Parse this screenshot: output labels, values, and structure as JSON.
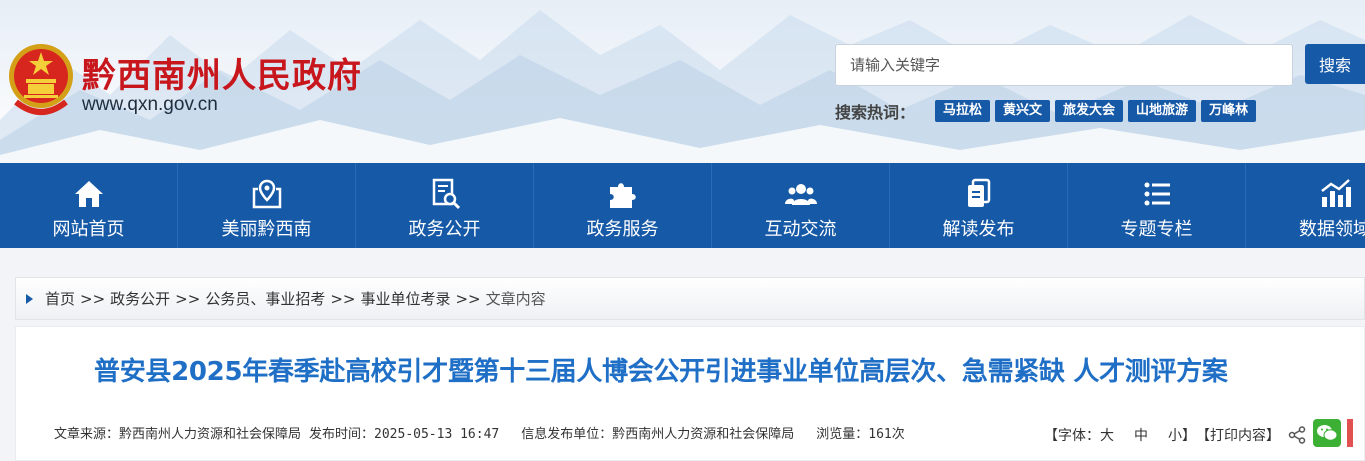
{
  "header": {
    "site_title": "黔西南州人民政府",
    "site_url": "www.qxn.gov.cn",
    "search_placeholder": "请输入关键字",
    "search_button": "搜索",
    "hot_label": "搜索热词：",
    "hot_tags": [
      "马拉松",
      "黄兴文",
      "旅发大会",
      "山地旅游",
      "万峰林"
    ]
  },
  "nav": {
    "items": [
      {
        "label": "网站首页",
        "icon": "home-icon"
      },
      {
        "label": "美丽黔西南",
        "icon": "map-pin-icon"
      },
      {
        "label": "政务公开",
        "icon": "document-search-icon"
      },
      {
        "label": "政务服务",
        "icon": "puzzle-icon"
      },
      {
        "label": "互动交流",
        "icon": "users-icon"
      },
      {
        "label": "解读发布",
        "icon": "files-icon"
      },
      {
        "label": "专题专栏",
        "icon": "list-icon"
      },
      {
        "label": "数据领域",
        "icon": "chart-icon"
      }
    ]
  },
  "breadcrumb": {
    "items": [
      "首页",
      "政务公开",
      "公务员、事业招考",
      "事业单位考录"
    ],
    "separator": ">>",
    "current": "文章内容"
  },
  "article": {
    "title": "普安县2025年春季赴高校引才暨第十三届人博会公开引进事业单位高层次、急需紧缺 人才测评方案",
    "source": "文章来源：黔西南州人力资源和社会保障局",
    "publish_time": "发布时间：2025-05-13 16:47",
    "publisher": "信息发布单位：黔西南州人力资源和社会保障局",
    "views": "浏览量：161次",
    "font_prefix": "【字体：",
    "font_large": "大",
    "font_medium": "中",
    "font_small": "小",
    "font_suffix": "】",
    "print": "【打印内容】"
  },
  "colors": {
    "primary": "#1659a7",
    "title_red": "#c8161d",
    "article_title": "#1f6fc6"
  }
}
